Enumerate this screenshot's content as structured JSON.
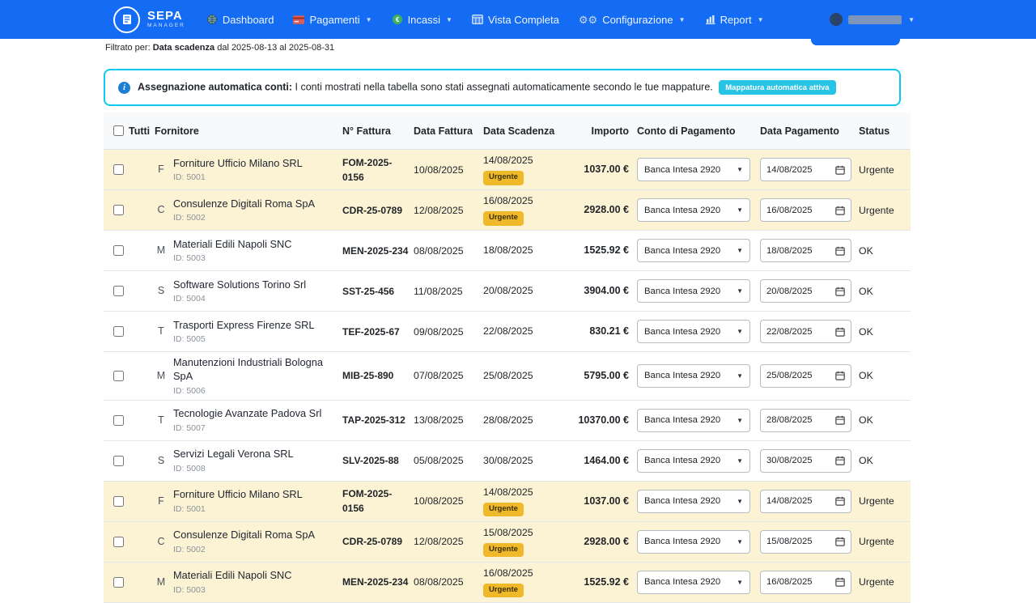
{
  "colors": {
    "navbar": "#146bf4",
    "info_border": "#0dcaf0",
    "info_badge": "#27c4e6",
    "warning_badge": "#efb929",
    "row_highlight": "#fcf2d4"
  },
  "navbar": {
    "brand_title": "SEPA",
    "brand_subtitle": "MANAGER",
    "items": [
      {
        "label": "Dashboard",
        "icon": "dashboard-globe-icon",
        "caret": false
      },
      {
        "label": "Pagamenti",
        "icon": "payments-card-icon",
        "caret": true
      },
      {
        "label": "Incassi",
        "icon": "income-coin-icon",
        "caret": true
      },
      {
        "label": "Vista Completa",
        "icon": "table-icon",
        "caret": false
      },
      {
        "label": "Configurazione",
        "icon": "gears-icon",
        "caret": true
      },
      {
        "label": "Report",
        "icon": "chart-icon",
        "caret": true
      }
    ]
  },
  "filter_bar": {
    "prefix": "Filtrato per:",
    "field": "Data scadenza",
    "range": "dal 2025-08-13 al 2025-08-31"
  },
  "alert": {
    "title": "Assegnazione automatica conti:",
    "message": "I conti mostrati nella tabella sono stati assegnati automaticamente secondo le tue mappature.",
    "badge": "Mappatura automatica attiva"
  },
  "table": {
    "columns": [
      "Tutti",
      "Fornitore",
      "N° Fattura",
      "Data Fattura",
      "Data Scadenza",
      "Importo",
      "Conto di Pagamento",
      "Data Pagamento",
      "Status"
    ],
    "urgent_badge_label": "Urgente",
    "rows": [
      {
        "letter": "F",
        "name": "Forniture Ufficio Milano SRL",
        "id": "ID: 5001",
        "invoice": "FOM-2025-0156",
        "invoice_date": "10/08/2025",
        "due_date": "14/08/2025",
        "urgent": true,
        "amount": "1037.00 €",
        "account": "Banca Intesa 2920",
        "payment_date": "14/08/2025",
        "status": "Urgente",
        "highlighted": true
      },
      {
        "letter": "C",
        "name": "Consulenze Digitali Roma SpA",
        "id": "ID: 5002",
        "invoice": "CDR-25-0789",
        "invoice_date": "12/08/2025",
        "due_date": "16/08/2025",
        "urgent": true,
        "amount": "2928.00 €",
        "account": "Banca Intesa 2920",
        "payment_date": "16/08/2025",
        "status": "Urgente",
        "highlighted": true
      },
      {
        "letter": "M",
        "name": "Materiali Edili Napoli SNC",
        "id": "ID: 5003",
        "invoice": "MEN-2025-234",
        "invoice_date": "08/08/2025",
        "due_date": "18/08/2025",
        "urgent": false,
        "amount": "1525.92 €",
        "account": "Banca Intesa 2920",
        "payment_date": "18/08/2025",
        "status": "OK",
        "highlighted": false
      },
      {
        "letter": "S",
        "name": "Software Solutions Torino Srl",
        "id": "ID: 5004",
        "invoice": "SST-25-456",
        "invoice_date": "11/08/2025",
        "due_date": "20/08/2025",
        "urgent": false,
        "amount": "3904.00 €",
        "account": "Banca Intesa 2920",
        "payment_date": "20/08/2025",
        "status": "OK",
        "highlighted": false
      },
      {
        "letter": "T",
        "name": "Trasporti Express Firenze SRL",
        "id": "ID: 5005",
        "invoice": "TEF-2025-67",
        "invoice_date": "09/08/2025",
        "due_date": "22/08/2025",
        "urgent": false,
        "amount": "830.21 €",
        "account": "Banca Intesa 2920",
        "payment_date": "22/08/2025",
        "status": "OK",
        "highlighted": false
      },
      {
        "letter": "M",
        "name": "Manutenzioni Industriali Bologna SpA",
        "id": "ID: 5006",
        "invoice": "MIB-25-890",
        "invoice_date": "07/08/2025",
        "due_date": "25/08/2025",
        "urgent": false,
        "amount": "5795.00 €",
        "account": "Banca Intesa 2920",
        "payment_date": "25/08/2025",
        "status": "OK",
        "highlighted": false
      },
      {
        "letter": "T",
        "name": "Tecnologie Avanzate Padova Srl",
        "id": "ID: 5007",
        "invoice": "TAP-2025-312",
        "invoice_date": "13/08/2025",
        "due_date": "28/08/2025",
        "urgent": false,
        "amount": "10370.00 €",
        "account": "Banca Intesa 2920",
        "payment_date": "28/08/2025",
        "status": "OK",
        "highlighted": false
      },
      {
        "letter": "S",
        "name": "Servizi Legali Verona SRL",
        "id": "ID: 5008",
        "invoice": "SLV-2025-88",
        "invoice_date": "05/08/2025",
        "due_date": "30/08/2025",
        "urgent": false,
        "amount": "1464.00 €",
        "account": "Banca Intesa 2920",
        "payment_date": "30/08/2025",
        "status": "OK",
        "highlighted": false
      },
      {
        "letter": "F",
        "name": "Forniture Ufficio Milano SRL",
        "id": "ID: 5001",
        "invoice": "FOM-2025-0156",
        "invoice_date": "10/08/2025",
        "due_date": "14/08/2025",
        "urgent": true,
        "amount": "1037.00 €",
        "account": "Banca Intesa 2920",
        "payment_date": "14/08/2025",
        "status": "Urgente",
        "highlighted": true
      },
      {
        "letter": "C",
        "name": "Consulenze Digitali Roma SpA",
        "id": "ID: 5002",
        "invoice": "CDR-25-0789",
        "invoice_date": "12/08/2025",
        "due_date": "15/08/2025",
        "urgent": true,
        "amount": "2928.00 €",
        "account": "Banca Intesa 2920",
        "payment_date": "15/08/2025",
        "status": "Urgente",
        "highlighted": true
      },
      {
        "letter": "M",
        "name": "Materiali Edili Napoli SNC",
        "id": "ID: 5003",
        "invoice": "MEN-2025-234",
        "invoice_date": "08/08/2025",
        "due_date": "16/08/2025",
        "urgent": true,
        "amount": "1525.92 €",
        "account": "Banca Intesa 2920",
        "payment_date": "16/08/2025",
        "status": "Urgente",
        "highlighted": true
      }
    ]
  }
}
